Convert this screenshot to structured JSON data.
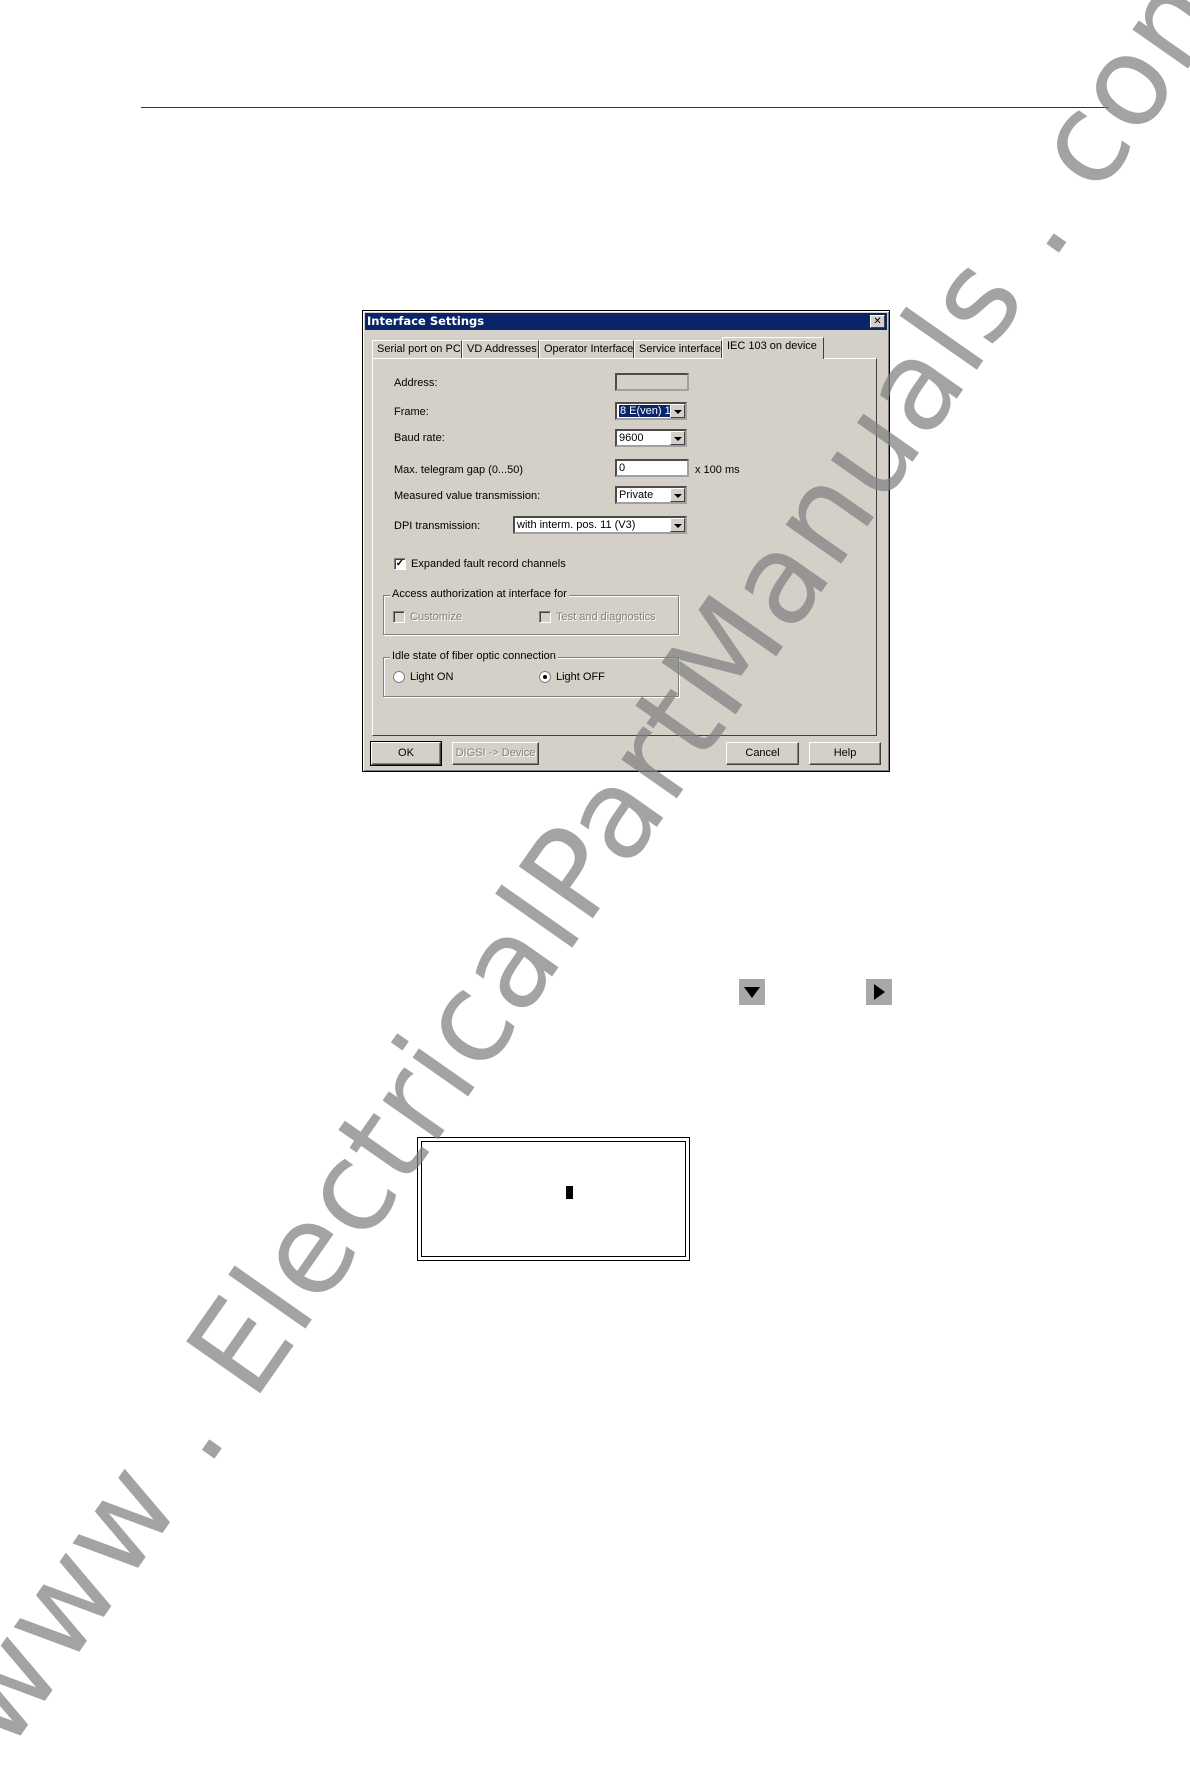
{
  "dialog": {
    "title": "Interface Settings",
    "close_glyph": "✕",
    "tabs": [
      {
        "label": "Serial port on PC",
        "active": false
      },
      {
        "label": "VD Addresses",
        "active": false
      },
      {
        "label": "Operator Interface",
        "active": false
      },
      {
        "label": "Service interface",
        "active": false
      },
      {
        "label": "IEC 103 on device",
        "active": true
      }
    ],
    "fields": {
      "address": {
        "label": "Address:",
        "value": ""
      },
      "frame": {
        "label": "Frame:",
        "value": "8 E(ven) 1"
      },
      "baud_rate": {
        "label": "Baud rate:",
        "value": "9600"
      },
      "telegram_gap": {
        "label": "Max. telegram gap (0...50)",
        "value": "0",
        "unit": "x 100 ms"
      },
      "measured_value": {
        "label": "Measured value transmission:",
        "value": "Private"
      },
      "dpi": {
        "label": "DPI transmission:",
        "value": "with interm. pos. 11 (V3)"
      }
    },
    "expanded_fault": {
      "label": "Expanded fault record channels",
      "checked": true,
      "check_glyph": "✓"
    },
    "access_group": {
      "title": "Access authorization at interface for",
      "customize": {
        "label": "Customize",
        "checked": false
      },
      "test_diag": {
        "label": "Test and diagnostics",
        "checked": false
      }
    },
    "idle_group": {
      "title": "Idle state of fiber optic connection",
      "light_on": {
        "label": "Light ON",
        "selected": false
      },
      "light_off": {
        "label": "Light OFF",
        "selected": true
      }
    },
    "buttons": {
      "ok": "OK",
      "digsi": "DIGSI -> Device",
      "cancel": "Cancel",
      "help": "Help"
    }
  },
  "nav_keys": {
    "down": "down-arrow-key",
    "right": "right-arrow-key"
  },
  "watermark": "www . ElectricalPartManuals . com"
}
